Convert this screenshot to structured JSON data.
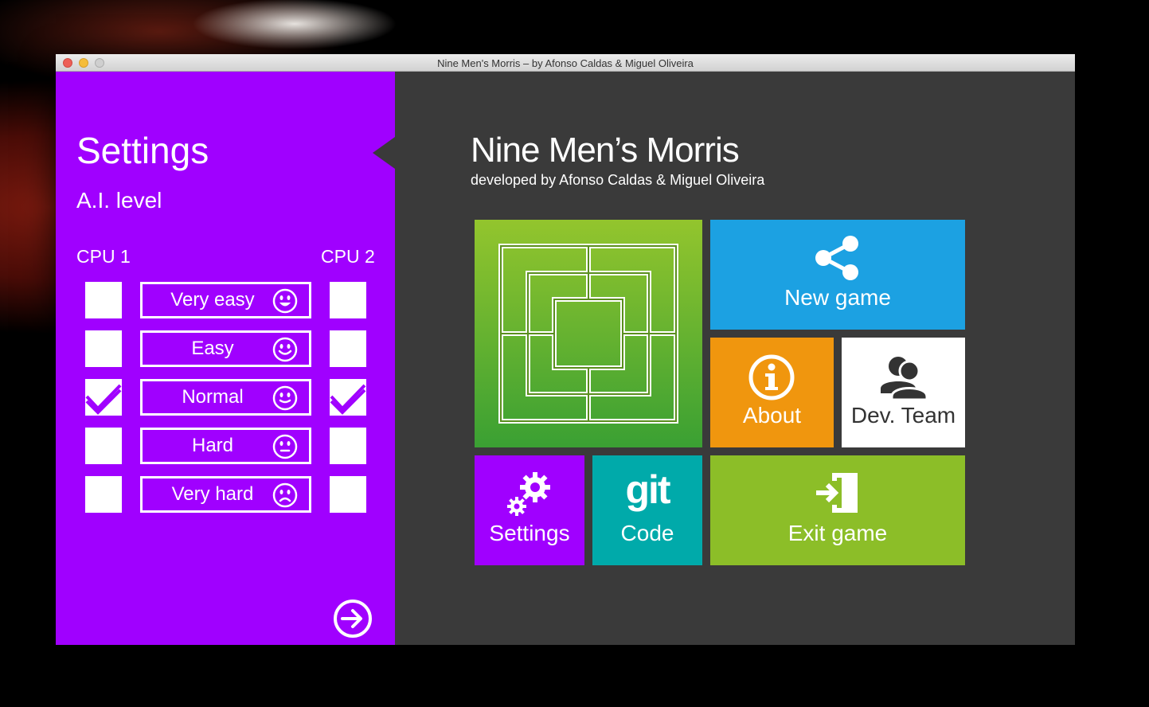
{
  "window": {
    "title": "Nine Men's Morris – by Afonso Caldas & Miguel Oliveira"
  },
  "sidebar": {
    "title": "Settings",
    "subtitle": "A.I. level",
    "cpu1_label": "CPU 1",
    "cpu2_label": "CPU 2",
    "levels": [
      {
        "label": "Very easy",
        "face": "big-smile-face-icon",
        "cpu1_checked": false,
        "cpu2_checked": false
      },
      {
        "label": "Easy",
        "face": "smile-face-icon",
        "cpu1_checked": false,
        "cpu2_checked": false
      },
      {
        "label": "Normal",
        "face": "slight-smile-face-icon",
        "cpu1_checked": true,
        "cpu2_checked": true
      },
      {
        "label": "Hard",
        "face": "neutral-face-icon",
        "cpu1_checked": false,
        "cpu2_checked": false
      },
      {
        "label": "Very hard",
        "face": "sad-face-icon",
        "cpu1_checked": false,
        "cpu2_checked": false
      }
    ],
    "next_icon": "arrow-right-circle-icon"
  },
  "main": {
    "title": "Nine Men’s Morris",
    "subtitle": "developed by Afonso Caldas & Miguel Oliveira",
    "tiles": {
      "new_game": "New game",
      "about": "About",
      "dev_team": "Dev. Team",
      "settings": "Settings",
      "git_logo": "git",
      "code": "Code",
      "exit_game": "Exit game"
    }
  },
  "colors": {
    "sidebar": "#a000ff",
    "background": "#3a3a3a",
    "new_game": "#1ca1e2",
    "about": "#f0960e",
    "dev_team": "#ffffff",
    "settings": "#a000ff",
    "code": "#00aaaa",
    "exit_game": "#8cbe28"
  }
}
